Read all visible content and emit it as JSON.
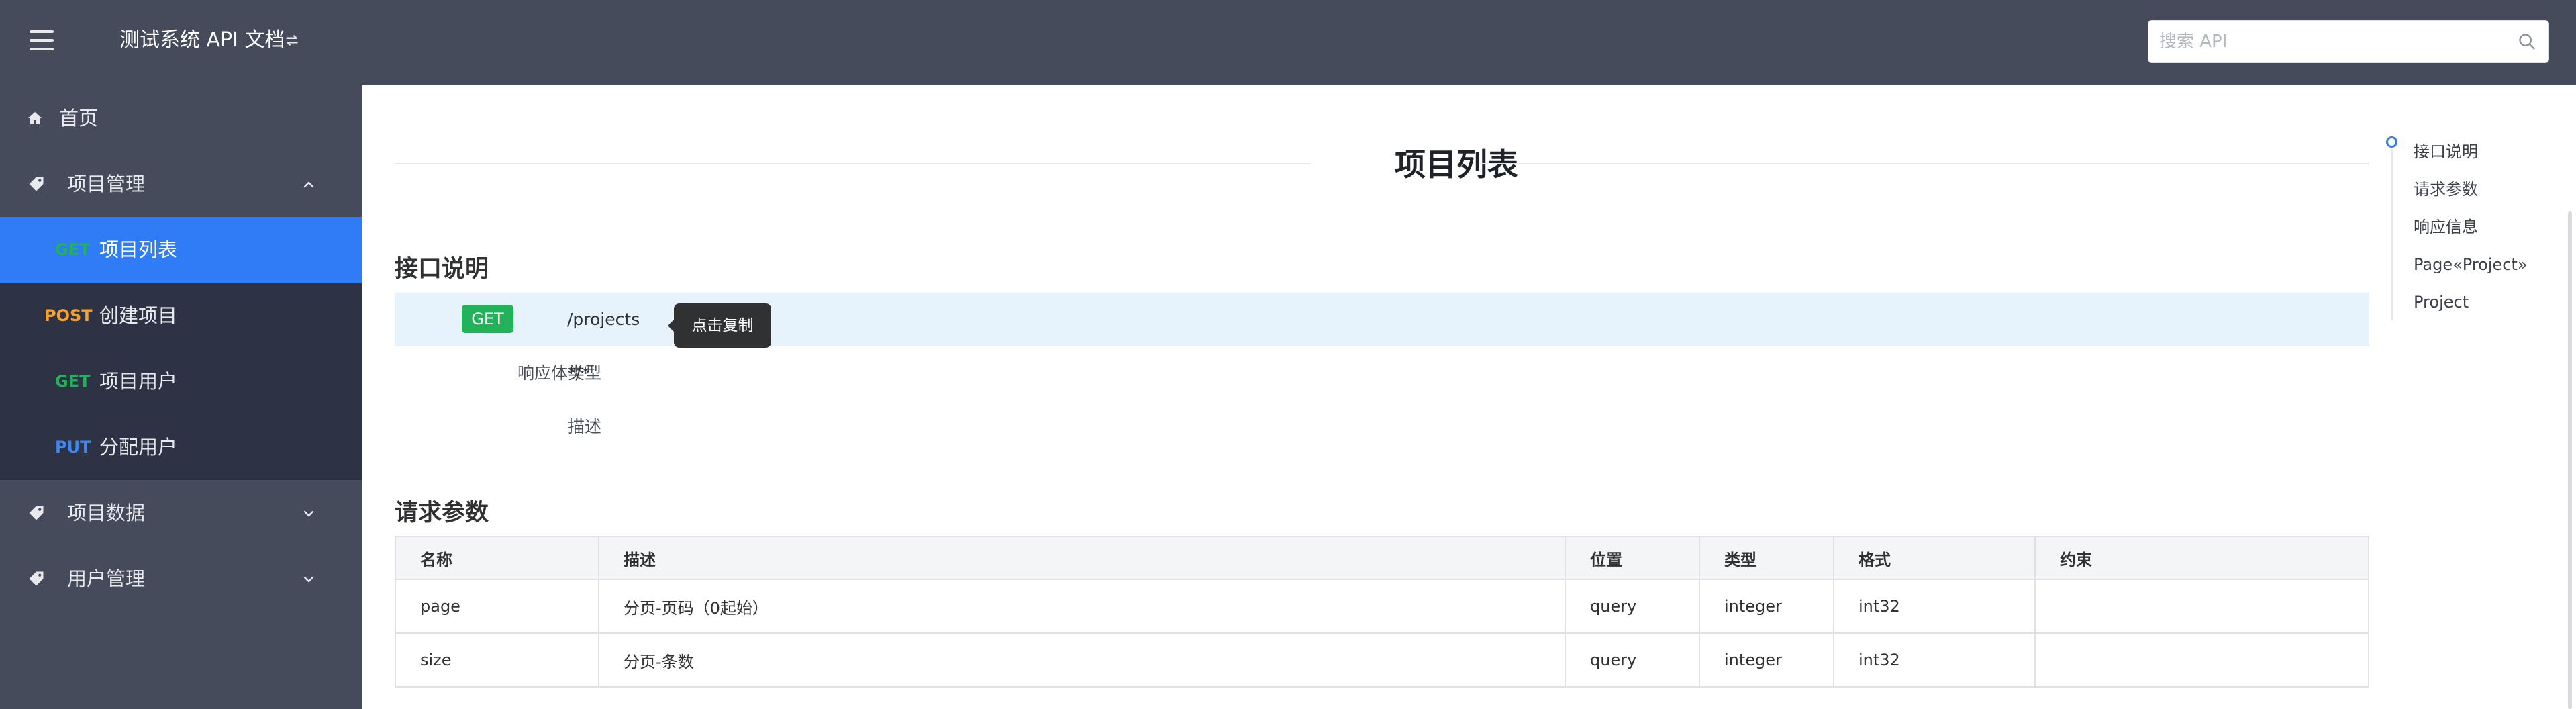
{
  "header": {
    "title": "测试系统 API 文档",
    "search_placeholder": "搜索 API"
  },
  "sidebar": {
    "home": "首页",
    "groups": [
      {
        "label": "项目管理",
        "expanded": true
      },
      {
        "label": "项目数据",
        "expanded": false
      },
      {
        "label": "用户管理",
        "expanded": false
      }
    ],
    "sub_items": [
      {
        "method": "GET",
        "label": "项目列表",
        "active": true
      },
      {
        "method": "POST",
        "label": "创建项目"
      },
      {
        "method": "GET",
        "label": "项目用户"
      },
      {
        "method": "PUT",
        "label": "分配用户"
      }
    ]
  },
  "colors": {
    "header_bg": "#464b5c",
    "submenu_bg": "#2d3244",
    "active_bg": "#2f7cf6",
    "get": "#21b25a",
    "post": "#f5a12d",
    "put": "#3d86f5"
  },
  "main": {
    "page_title": "项目列表",
    "section_interface": "接口说明",
    "method": "GET",
    "path": "/projects",
    "tooltip": "点击复制",
    "response_type_label": "响应体类型",
    "response_type": "*/*",
    "description_label": "描述",
    "section_params": "请求参数",
    "table": {
      "headers": [
        "名称",
        "描述",
        "位置",
        "类型",
        "格式",
        "约束"
      ],
      "rows": [
        [
          "page",
          "分页-页码（0起始）",
          "query",
          "integer",
          "int32",
          ""
        ],
        [
          "size",
          "分页-条数",
          "query",
          "integer",
          "int32",
          ""
        ]
      ]
    }
  },
  "toc": {
    "items": [
      "接口说明",
      "请求参数",
      "响应信息",
      "Page«Project»",
      "Project"
    ]
  }
}
